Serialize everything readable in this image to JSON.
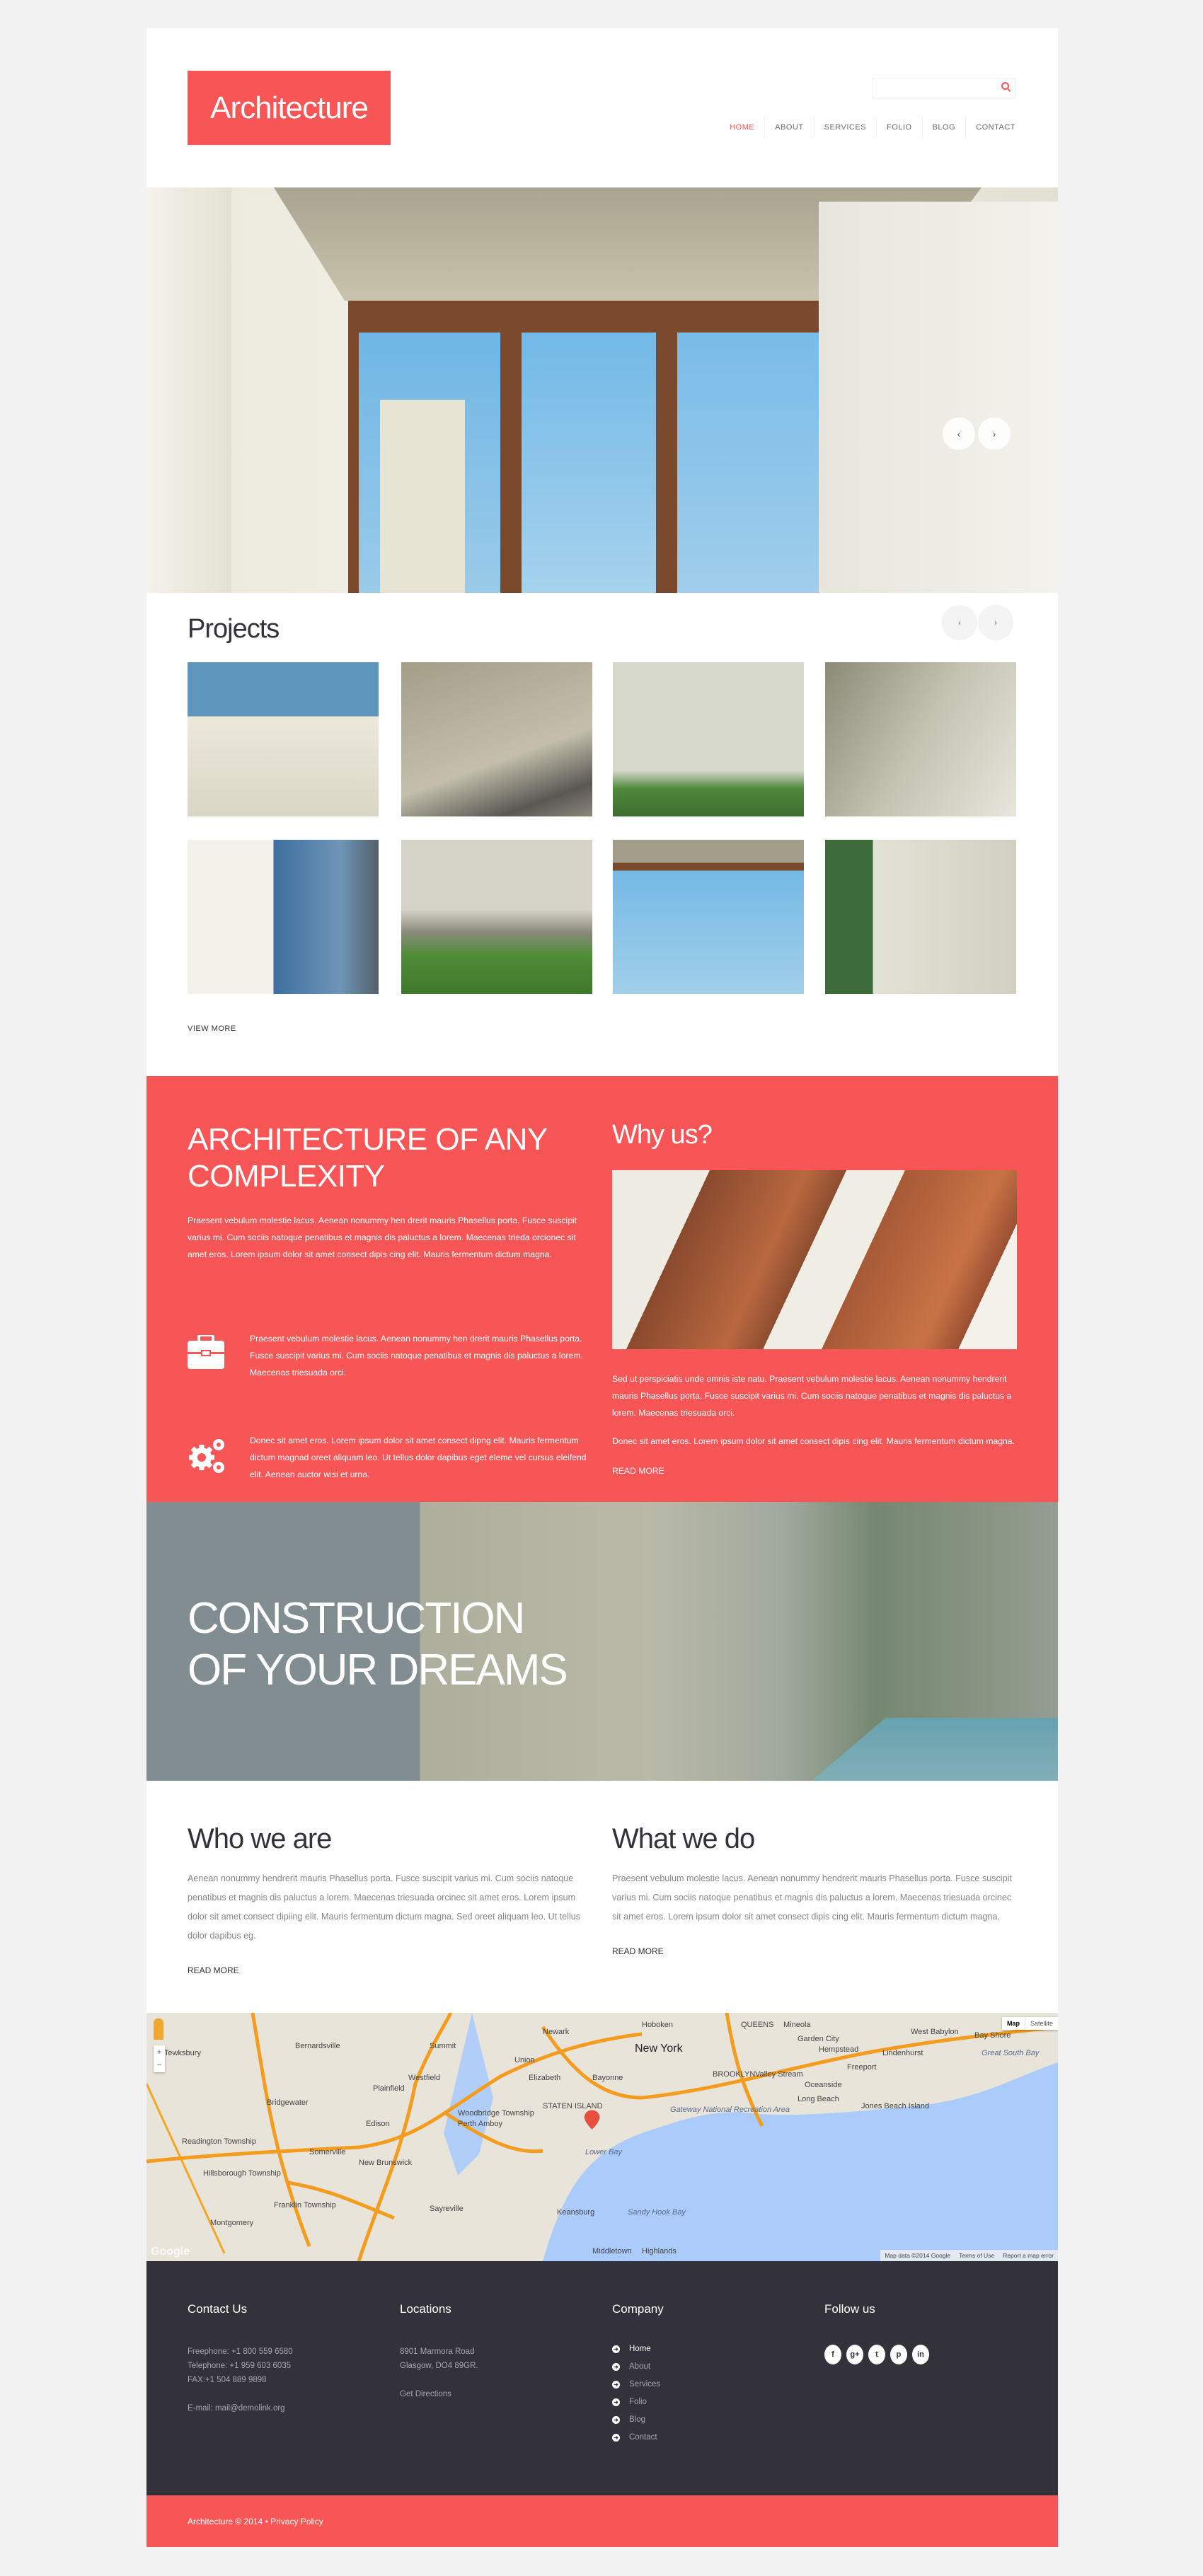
{
  "header": {
    "logo": "Architecture",
    "search": {
      "placeholder": "",
      "icon": "search-icon"
    },
    "nav": [
      "HOME",
      "ABOUT",
      "SERVICES",
      "FOLIO",
      "BLOG",
      "CONTACT"
    ],
    "active": "HOME"
  },
  "hero": {
    "prev": "‹",
    "next": "›"
  },
  "projects": {
    "title": "Projects",
    "prev": "‹",
    "next": "›",
    "view_more": "VIEW MORE"
  },
  "complexity": {
    "title": "ARCHITECTURE OF ANY COMPLEXITY",
    "text": "Praesent vebulum molestie lacus. Aenean nonummy hen drerit mauris Phasellus porta. Fusce suscipit varius mi. Cum sociis natoque penatibus et magnis dis paluctus a lorem. Maecenas trieda orcionec sit amet eros. Lorem ipsum dolor sit amet consect dipis cing elit. Mauris fermentum dictum magna.",
    "features": [
      {
        "icon": "briefcase-icon",
        "text": "Praesent vebulum molestie lacus. Aenean nonummy hen drerit mauris Phasellus porta. Fusce suscipit varius mi. Cum sociis natoque penatibus et magnis dis paluctus a lorem. Maecenas triesuada orci."
      },
      {
        "icon": "gears-icon",
        "text": "Donec sit amet eros. Lorem ipsum dolor sit amet consect dipng elit. Mauris fermentum dictum magnad oreet aliquam leo. Ut tellus dolor dapibus eget eleme vel cursus eleifend elit. Aenean auctor wisi et urna."
      }
    ]
  },
  "why": {
    "title": "Why us?",
    "p1": "Sed ut perspiciatis unde omnis iste natu. Praesent vebulum molestie lacus. Aenean nonummy hendrerit mauris Phasellus porta. Fusce suscipit varius mi. Cum sociis natoque penatibus et magnis dis paluctus a lorem. Maecenas triesuada orci.",
    "p2": "Donec sit amet eros. Lorem ipsum dolor sit amet consect dipis cing elit. Mauris fermentum dictum magna.",
    "read_more": "READ MORE"
  },
  "banner": {
    "line1": "CONSTRUCTION",
    "line2": "OF YOUR DREAMS"
  },
  "who": {
    "title": "Who we are",
    "text": "Aenean nonummy hendrerit mauris Phasellus porta. Fusce suscipit varius mi. Cum sociis natoque penatibus et magnis dis paluctus a lorem. Maecenas triesuada orcinec sit amet eros. Lorem ipsum dolor sit amet consect dipiing elit. Mauris fermentum dictum magna. Sed oreet aliquam leo. Ut tellus dolor dapibus eg.",
    "read_more": "READ MORE"
  },
  "what": {
    "title": "What we do",
    "text": "Praesent vebulum molestie lacus. Aenean nonummy hendrerit mauris Phasellus porta. Fusce suscipit varius mi. Cum sociis natoque penatibus et magnis dis paluctus a lorem. Maecenas triesuada orcinec sit amet eros. Lorem ipsum dolor sit amet consect dipis cing elit. Mauris fermentum dictum magna.",
    "read_more": "READ MORE"
  },
  "map": {
    "type_map": "Map",
    "type_satellite": "Satellite",
    "zoom_in": "+",
    "zoom_out": "−",
    "attribution": "Map data ©2014 Google",
    "terms": "Terms of Use",
    "report": "Report a map error",
    "google": "Google",
    "labels": [
      "Newark",
      "New York",
      "Union",
      "Elizabeth",
      "Bayonne",
      "Hoboken",
      "QUEENS",
      "BROOKLYN",
      "STATEN ISLAND",
      "Edison",
      "New Brunswick",
      "Perth Amboy",
      "Plainfield",
      "Westfield",
      "Summit",
      "Bernardsville",
      "Bridgewater",
      "Somerville",
      "Hempstead",
      "Garden City",
      "Mineola",
      "Freeport",
      "Long Beach",
      "Oceanside",
      "Valley Stream",
      "West Babylon",
      "Bay Shore",
      "Lindenhurst",
      "Lower Bay",
      "Sandy Hook Bay",
      "Great South Bay",
      "Jones Beach Island",
      "Gateway National Recreation Area",
      "Keansburg",
      "Sayreville",
      "Woodbridge Township",
      "Tewksbury",
      "Readington Township",
      "Hillsborough Township",
      "Franklin Township",
      "Montgomery",
      "Middletown",
      "Highlands"
    ]
  },
  "footer": {
    "contact": {
      "title": "Contact Us",
      "freephone": "Freephone: +1 800 559 6580",
      "telephone": "Telephone: +1 959 603 6035",
      "fax": "FAX:+1 504 889 9898",
      "email": "E-mail: mail@demolink.org"
    },
    "locations": {
      "title": "Locations",
      "line1": "8901 Marmora Road",
      "line2": "Glasgow, DO4 89GR.",
      "directions": "Get Directions"
    },
    "company": {
      "title": "Company",
      "links": [
        "Home",
        "About",
        "Services",
        "Folio",
        "Blog",
        "Contact"
      ]
    },
    "follow": {
      "title": "Follow us",
      "icons": [
        {
          "name": "facebook-icon",
          "glyph": "f"
        },
        {
          "name": "google-plus-icon",
          "glyph": "g+"
        },
        {
          "name": "twitter-icon",
          "glyph": "t"
        },
        {
          "name": "pinterest-icon",
          "glyph": "p"
        },
        {
          "name": "linkedin-icon",
          "glyph": "in"
        }
      ]
    }
  },
  "bottom": {
    "copyright": "Architecture © 2014",
    "separator": "•",
    "privacy": "Privacy Policy"
  },
  "colors": {
    "accent": "#f85656",
    "dark": "#33313a",
    "bg": "#f2f2f2"
  }
}
